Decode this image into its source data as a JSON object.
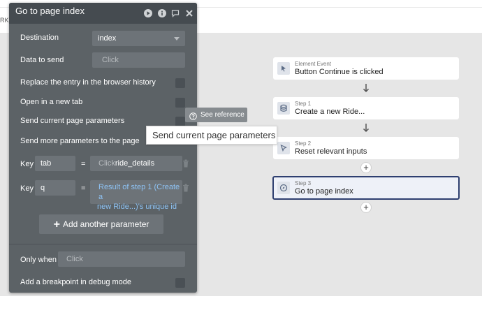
{
  "topbar": {
    "partial_text": "RKF"
  },
  "panel": {
    "title": "Go to page index",
    "destination": {
      "label": "Destination",
      "value": "index"
    },
    "data_to_send": {
      "label": "Data to send",
      "placeholder": "Click"
    },
    "replace_entry": {
      "label": "Replace the entry in the browser history"
    },
    "open_new_tab": {
      "label": "Open in a new tab"
    },
    "send_current_params": {
      "label": "Send current page parameters"
    },
    "send_more_params": {
      "label": "Send more parameters to the page"
    },
    "params": [
      {
        "key_label": "Key",
        "key": "tab",
        "eq": "=",
        "value_placeholder": "Click",
        "value": "ride_details"
      },
      {
        "key_label": "Key",
        "key": "q",
        "eq": "=",
        "value_line1": "Result of step 1 (Create a",
        "value_line2": "new Ride...)'s unique id"
      }
    ],
    "add_param_label": "Add another parameter",
    "only_when": {
      "label": "Only when",
      "placeholder": "Click"
    },
    "breakpoint": {
      "label": "Add a breakpoint in debug mode"
    }
  },
  "see_reference": {
    "label": "See reference"
  },
  "tooltip": {
    "text": "Send current page parameters"
  },
  "workflow": {
    "cards": [
      {
        "small": "Element Event",
        "main": "Button Continue is clicked",
        "icon": "cursor-click-icon"
      },
      {
        "small": "Step 1",
        "main": "Create a new Ride...",
        "icon": "database-icon"
      },
      {
        "small": "Step 2",
        "main": "Reset relevant inputs",
        "icon": "pointer-icon"
      },
      {
        "small": "Step 3",
        "main": "Go to page index",
        "icon": "compass-icon"
      }
    ],
    "plus": "+"
  },
  "colors": {
    "panel_bg": "#5c6266",
    "header_bg": "#454b50",
    "dynamic_text": "#8ec3f5",
    "selected_border": "#2e3f70"
  }
}
